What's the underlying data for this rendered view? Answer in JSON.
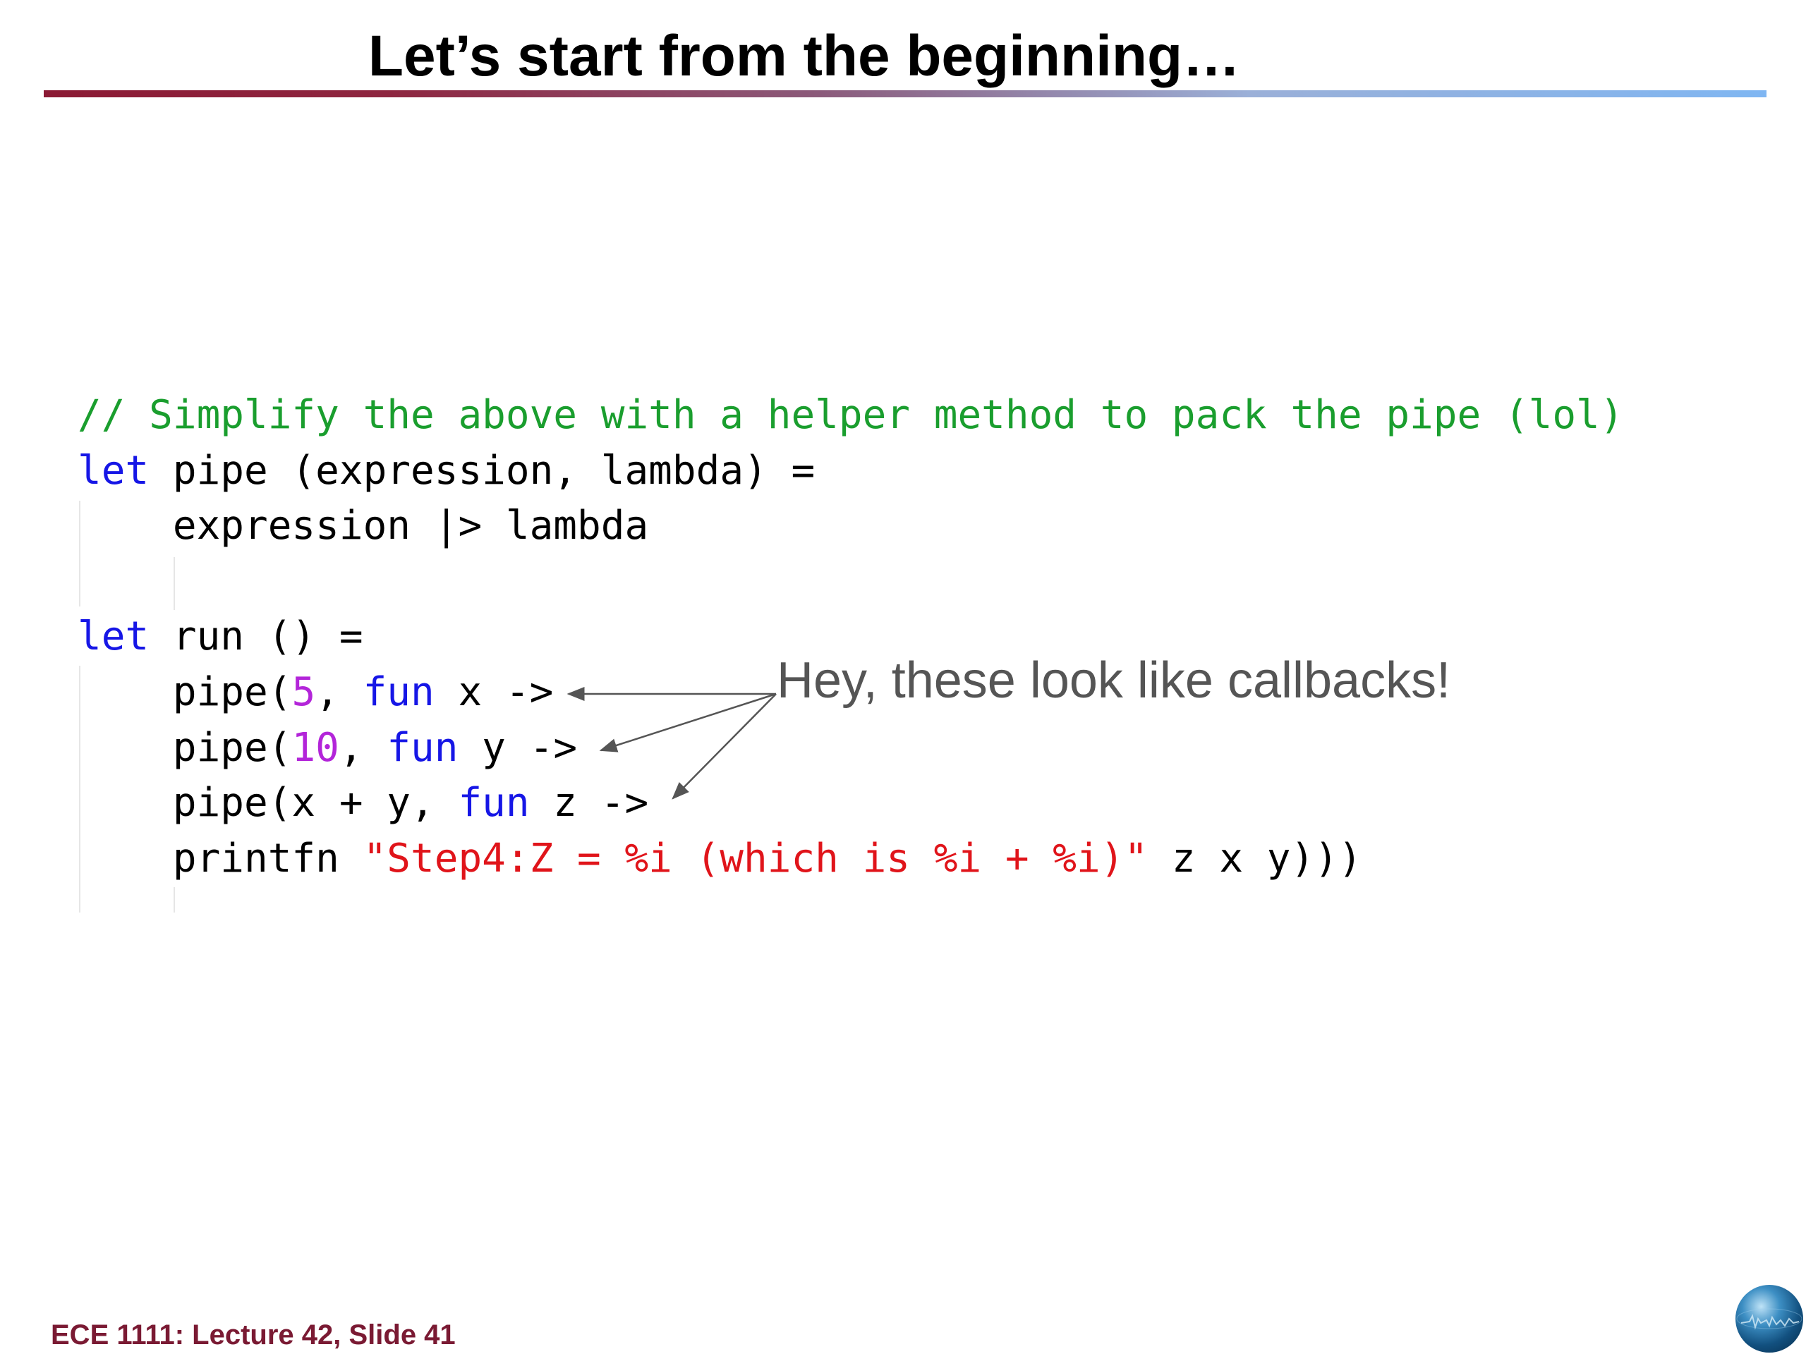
{
  "slide": {
    "title": "Let’s start from the beginning…",
    "footer": "ECE 1111: Lecture 42, Slide 41"
  },
  "code": {
    "lines": [
      [
        {
          "t": "// Simplify the above with a helper method to pack the pipe (lol)",
          "k": "comment"
        }
      ],
      [
        {
          "t": "let",
          "k": "kw"
        },
        {
          "t": " pipe (expression, lambda) =",
          "k": "plain"
        }
      ],
      [
        {
          "t": "    expression |> lambda",
          "k": "plain"
        }
      ],
      [],
      [
        {
          "t": "let",
          "k": "kw"
        },
        {
          "t": " run () =",
          "k": "plain"
        }
      ],
      [
        {
          "t": "    pipe(",
          "k": "plain"
        },
        {
          "t": "5",
          "k": "num"
        },
        {
          "t": ", ",
          "k": "plain"
        },
        {
          "t": "fun",
          "k": "kw"
        },
        {
          "t": " x ->",
          "k": "plain"
        }
      ],
      [
        {
          "t": "    pipe(",
          "k": "plain"
        },
        {
          "t": "10",
          "k": "num"
        },
        {
          "t": ", ",
          "k": "plain"
        },
        {
          "t": "fun",
          "k": "kw"
        },
        {
          "t": " y ->",
          "k": "plain"
        }
      ],
      [
        {
          "t": "    pipe(x + y, ",
          "k": "plain"
        },
        {
          "t": "fun",
          "k": "kw"
        },
        {
          "t": " z ->",
          "k": "plain"
        }
      ],
      [
        {
          "t": "    printfn ",
          "k": "plain"
        },
        {
          "t": "\"Step4:Z = %i (which is %i + %i)\"",
          "k": "str"
        },
        {
          "t": " z x y)))",
          "k": "plain"
        }
      ]
    ]
  },
  "callout": {
    "text": "Hey, these look like callbacks!"
  },
  "colors": {
    "comment": "#1a9e2e",
    "keyword": "#1616e6",
    "number": "#b325d9",
    "string": "#e0141a",
    "footer": "#7a1a33",
    "callout": "#555555"
  },
  "icons": {
    "logo": "globe-logo-icon"
  }
}
